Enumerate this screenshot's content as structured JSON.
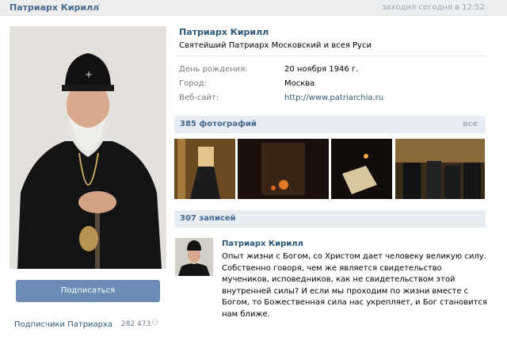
{
  "topbar": {
    "name": "Патриарх Кирилл",
    "status": "заходил сегодня в 12:52"
  },
  "profile": {
    "name": "Патриарх Кирилл",
    "title": "Святейший Патриарх Московский и всея Руси",
    "info": [
      {
        "label": "День рождения:",
        "value": "20 ноября 1946 г."
      },
      {
        "label": "Город:",
        "value": "Москва"
      },
      {
        "label": "Веб-сайт:",
        "value": "http://www.patriarchia.ru"
      }
    ]
  },
  "subscribe_button": "Подписаться",
  "followers": {
    "label": "Подписчики Патриарха",
    "count": "282 473"
  },
  "photos": {
    "title": "385 фотографий",
    "more": "все"
  },
  "posts": {
    "title": "307 записей",
    "items": [
      {
        "author": "Патриарх Кирилл",
        "text": "Опыт жизни с Богом, со Христом дает человеку великую силу. Собственно говоря, чем же является свидетельство мучеников, исповедников, как не свидетельством этой внутренней силы? И если мы проходим по жизни вместе с Богом, то Божественная сила нас укрепляет, и Бог становится нам ближе."
      }
    ]
  },
  "colors": {
    "link": "#2b587a",
    "header_bg": "#e8edf3",
    "button": "#6b8db5"
  }
}
